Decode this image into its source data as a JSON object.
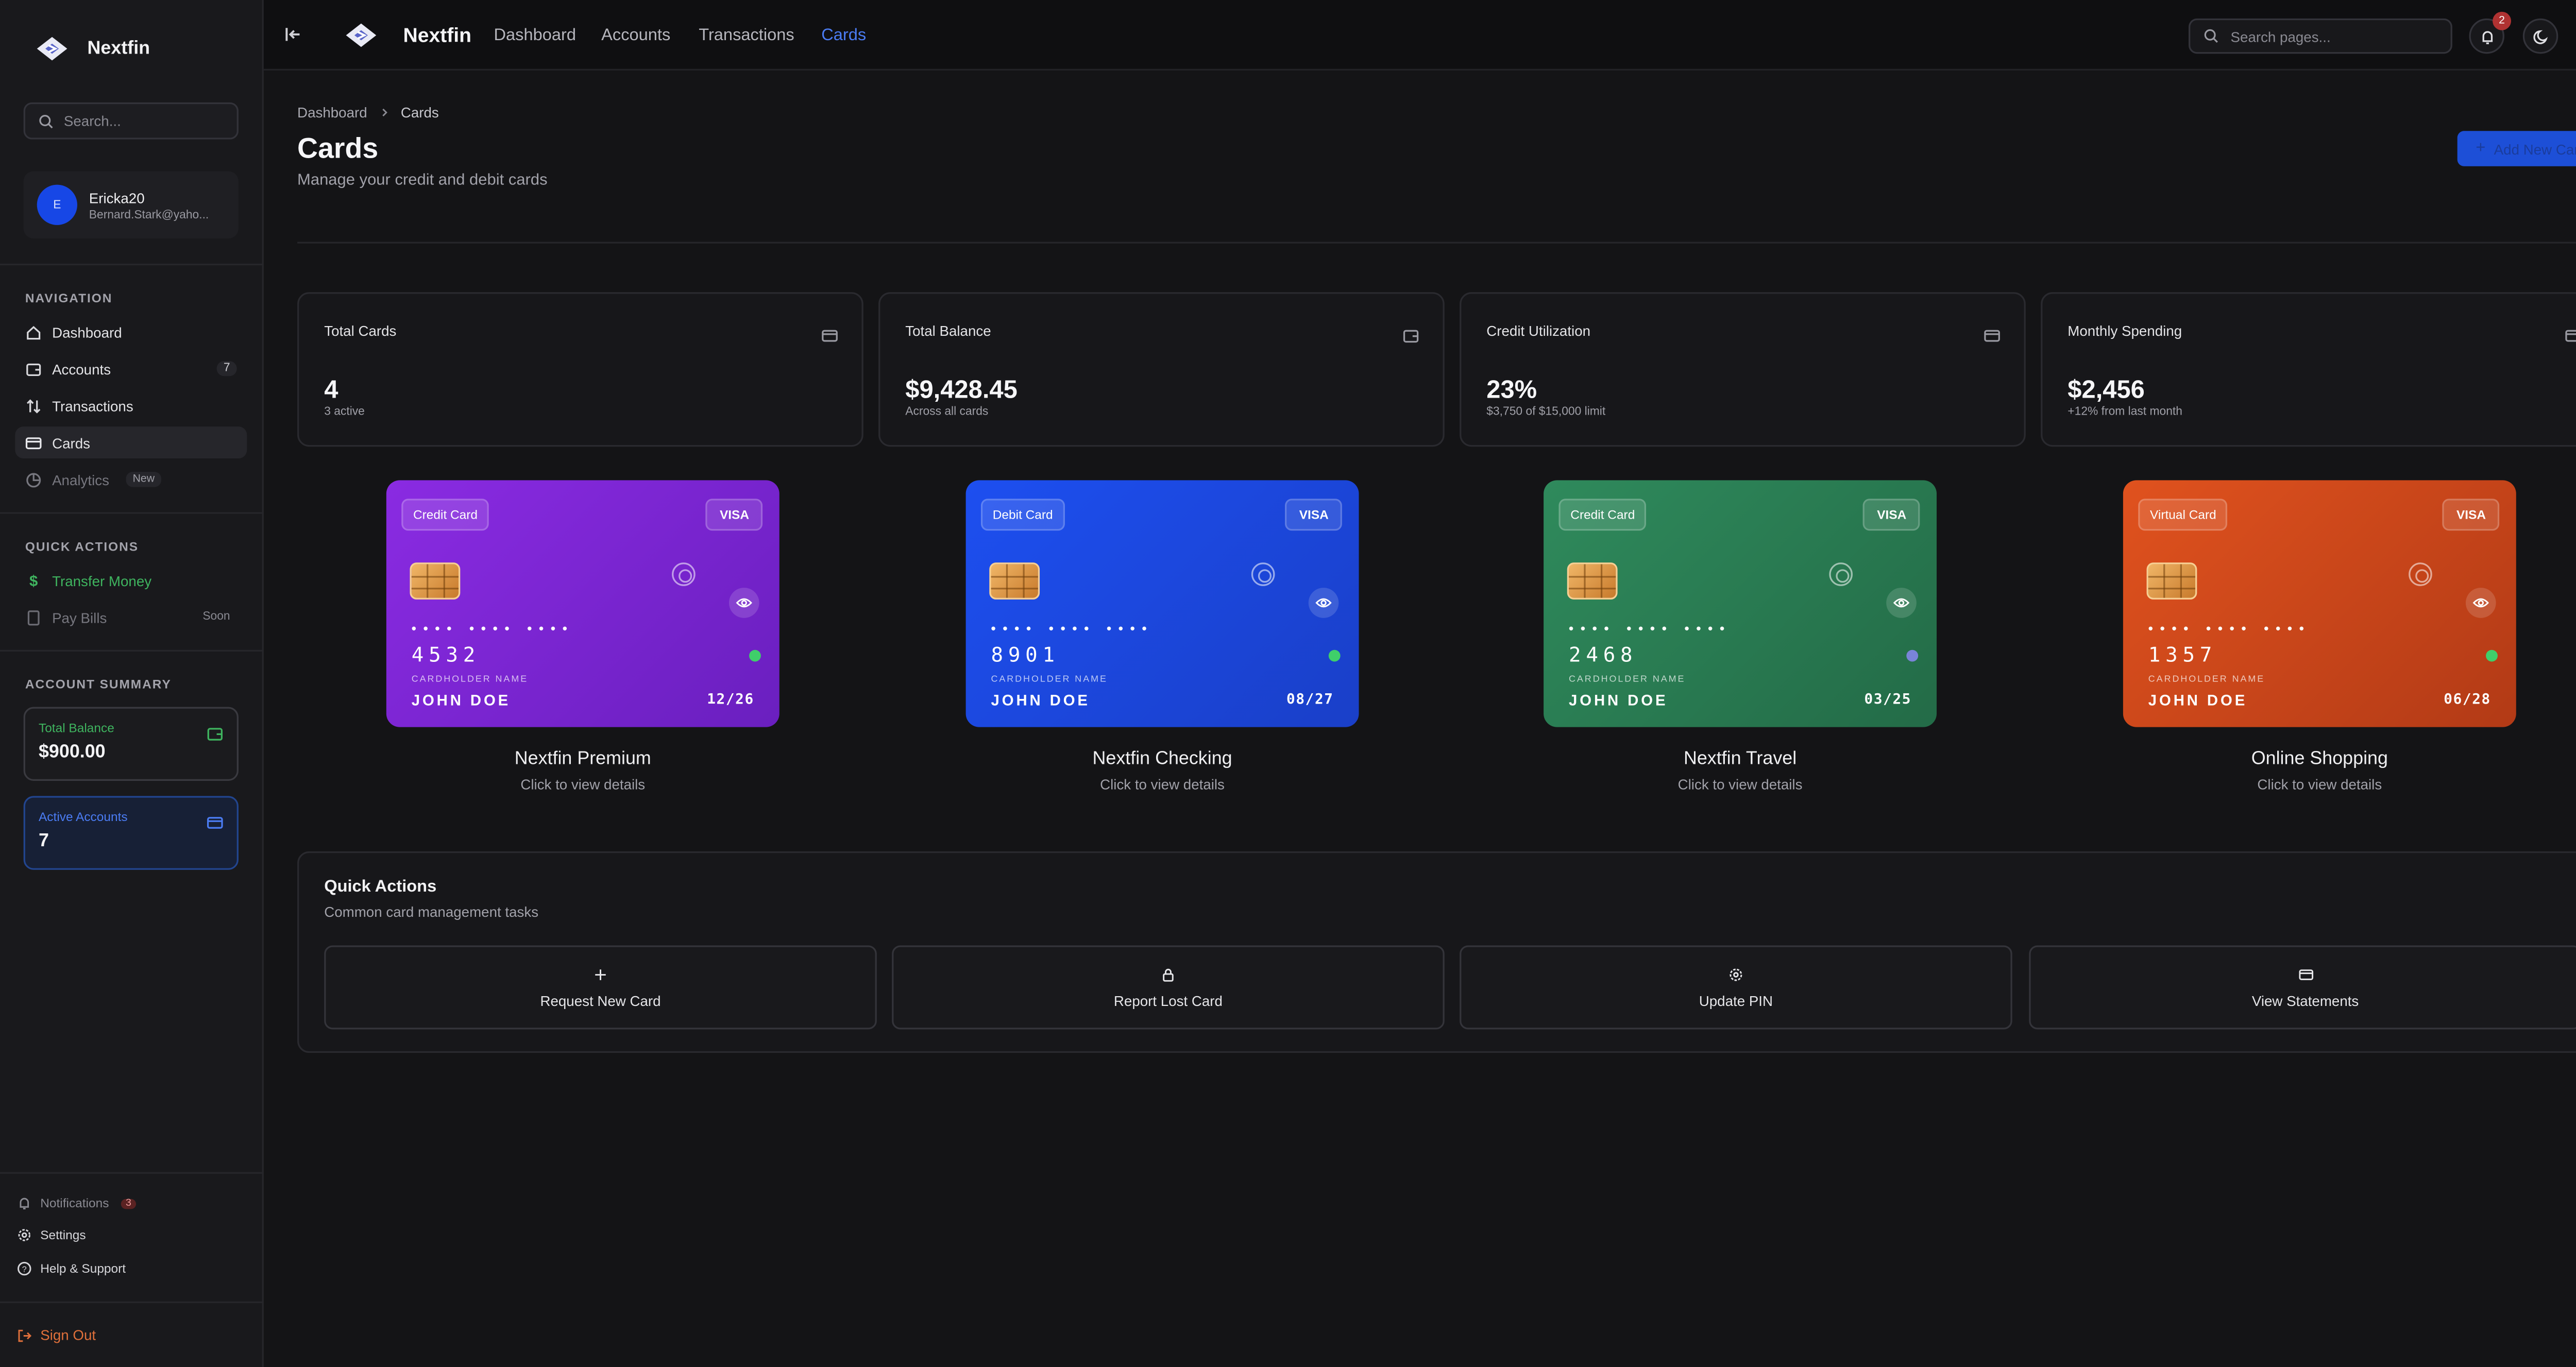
{
  "app": {
    "name": "Nextfin"
  },
  "sidebar": {
    "search_placeholder": "Search...",
    "user": {
      "name": "Ericka20",
      "email": "Bernard.Stark@yaho...",
      "initial": "E"
    },
    "nav_label": "NAVIGATION",
    "nav": [
      {
        "label": "Dashboard",
        "icon": "home-icon"
      },
      {
        "label": "Accounts",
        "icon": "wallet-icon",
        "count": "7"
      },
      {
        "label": "Transactions",
        "icon": "arrows-updown-icon"
      },
      {
        "label": "Cards",
        "icon": "credit-card-icon",
        "active": true
      },
      {
        "label": "Analytics",
        "icon": "chart-icon",
        "pill": "New"
      }
    ],
    "quick_label": "QUICK ACTIONS",
    "quick": [
      {
        "label": "Transfer Money",
        "icon": "dollar-icon"
      },
      {
        "label": "Pay Bills",
        "icon": "receipt-icon",
        "tag": "Soon"
      }
    ],
    "summary_label": "ACCOUNT SUMMARY",
    "summary": [
      {
        "label": "Total Balance",
        "value": "$900.00",
        "color": "#3fb45f"
      },
      {
        "label": "Active Accounts",
        "value": "7",
        "color": "#4b7cf3"
      }
    ],
    "footer": [
      {
        "label": "Notifications",
        "badge": "3"
      },
      {
        "label": "Settings"
      },
      {
        "label": "Help & Support"
      },
      {
        "label": "Sign Out"
      }
    ]
  },
  "topbar": {
    "brand": "Nextfin",
    "links": [
      "Dashboard",
      "Accounts",
      "Transactions",
      "Cards"
    ],
    "active_link": "Cards",
    "search_placeholder": "Search pages...",
    "notif_count": "2"
  },
  "page": {
    "breadcrumb": [
      "Dashboard",
      "Cards"
    ],
    "title": "Cards",
    "subtitle": "Manage your credit and debit cards",
    "add_button": "Add New Card"
  },
  "stats": [
    {
      "label": "Total Cards",
      "value": "4",
      "sub": "3 active",
      "icon": "credit-card-icon"
    },
    {
      "label": "Total Balance",
      "value": "$9,428.45",
      "sub": "Across all cards",
      "icon": "wallet-icon"
    },
    {
      "label": "Credit Utilization",
      "value": "23%",
      "sub": "$3,750 of $15,000 limit",
      "icon": "credit-card-icon"
    },
    {
      "label": "Monthly Spending",
      "value": "$2,456",
      "sub": "+12% from last month",
      "icon": "credit-card-icon"
    }
  ],
  "cards": [
    {
      "type": "Credit Card",
      "network": "VISA",
      "masked": "•••• •••• ••••",
      "last4": "4532",
      "holder_label": "CARDHOLDER NAME",
      "holder": "JOHN DOE",
      "expiry": "12/26",
      "name": "Nextfin Premium",
      "hint": "Click to view details",
      "status_color": "#3fcf6a",
      "gradient": [
        "#8a2be2",
        "#6a1fbf"
      ]
    },
    {
      "type": "Debit Card",
      "network": "VISA",
      "masked": "•••• •••• ••••",
      "last4": "8901",
      "holder_label": "CARDHOLDER NAME",
      "holder": "JOHN DOE",
      "expiry": "08/27",
      "name": "Nextfin Checking",
      "hint": "Click to view details",
      "status_color": "#3fcf6a",
      "gradient": [
        "#1d4ff0",
        "#1a3fc8"
      ]
    },
    {
      "type": "Credit Card",
      "network": "VISA",
      "masked": "•••• •••• ••••",
      "last4": "2468",
      "holder_label": "CARDHOLDER NAME",
      "holder": "JOHN DOE",
      "expiry": "03/25",
      "name": "Nextfin Travel",
      "hint": "Click to view details",
      "status_color": "#7a84d8",
      "gradient": [
        "#2f8a5c",
        "#236b47"
      ]
    },
    {
      "type": "Virtual Card",
      "network": "VISA",
      "masked": "•••• •••• ••••",
      "last4": "1357",
      "holder_label": "CARDHOLDER NAME",
      "holder": "JOHN DOE",
      "expiry": "06/28",
      "name": "Online Shopping",
      "hint": "Click to view details",
      "status_color": "#3fcf6a",
      "gradient": [
        "#e0521e",
        "#b23a16"
      ]
    }
  ],
  "quick_actions": {
    "title": "Quick Actions",
    "subtitle": "Common card management tasks",
    "buttons": [
      {
        "label": "Request New Card",
        "icon": "plus-icon"
      },
      {
        "label": "Report Lost Card",
        "icon": "lock-icon"
      },
      {
        "label": "Update PIN",
        "icon": "gear-icon"
      },
      {
        "label": "View Statements",
        "icon": "credit-card-icon"
      }
    ]
  }
}
